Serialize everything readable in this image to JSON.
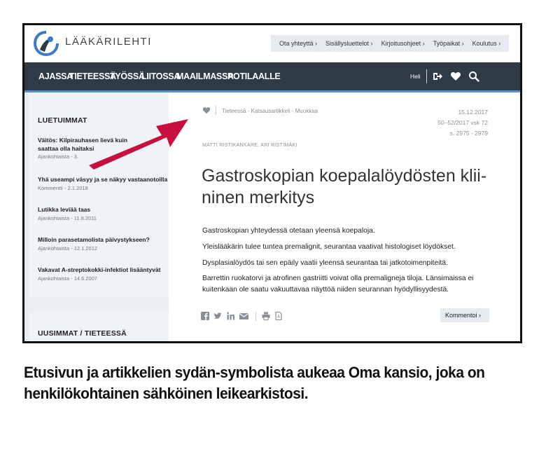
{
  "site": {
    "brand": "LÄÄKÄRILEHTI",
    "utility_nav": [
      "Ota yhteyttä ›",
      "Sisällysluettelot ›",
      "Kirjoitusohjeet ›",
      "Työpaikat ›",
      "Koulutus ›"
    ]
  },
  "main_nav": {
    "items": [
      "AJASSA",
      "TIETEESSÄ",
      "TYÖSSÄ",
      "LIITOSSA",
      "MAAILMASSA",
      "POTILAALLE"
    ],
    "user": "Heli",
    "icons": [
      "logout-icon",
      "heart-icon",
      "search-icon"
    ]
  },
  "sidebar": {
    "popular_title": "LUETUIMMAT",
    "items": [
      {
        "headline": "Väitös: Kilpirauhasen lievä kuin",
        "headline2": "saattaa olla haitaksi",
        "meta": "Ajankohtaista - 3."
      },
      {
        "headline": "Yhä useampi väsyy ja se näkyy vastaanotoilla",
        "meta": "Kommentti - 2.1.2018"
      },
      {
        "headline": "Lutikka leviää taas",
        "meta": "Ajankohtaista - 11.8.2011"
      },
      {
        "headline": "Milloin parasetamolista päivystykseen?",
        "meta": "Ajankohtaista - 12.1.2012"
      },
      {
        "headline": "Vakavat A-streptokokki-infektiot lisääntyvät",
        "meta": "Ajankohtaista - 14.6.2007"
      }
    ],
    "latest_title": "UUSIMMAT / TIETEESSÄ"
  },
  "article": {
    "breadcrumb": "Tieteessä - Katsausartikkeli - Muokkaa",
    "date": "15.12.2017",
    "issue": "50–52/2017 vsk 72",
    "pages": "s. 2975 - 2979",
    "authors": "MATTI RISTIKANKARE,  ARI RISTIMÄKI",
    "title": "Gastroskopian koepalalöydösten klii-ninen merkitys",
    "paragraphs": [
      "Gastroskopian yhteydessä otetaan yleensä koepaloja.",
      "Yleislääkärin tulee tuntea premalignit, seurantaa vaativat histologiset löydökset.",
      "Dysplasialöydös tai sen epäily vaatii yleensä seurantaa tai jatkotoimenpiteitä.",
      "Barrettin ruokatorvi ja atrofinen gastriitti voivat olla premaligneja tiloja. Länsimaissa ei kuitenkaan ole saatu vakuuttavaa näyttöä niiden seurannan hyödyllisyydestä."
    ],
    "comment_button": "Kommentoi ›"
  },
  "colors": {
    "nav_bg": "#2f3a47",
    "accent_blue": "#5b8fd3",
    "arrow": "#c8103e"
  },
  "caption": "Etusivun ja artikkelien sydän-symbolista aukeaa Oma kansio, joka on henkilökohtainen sähköinen leikearkistosi."
}
